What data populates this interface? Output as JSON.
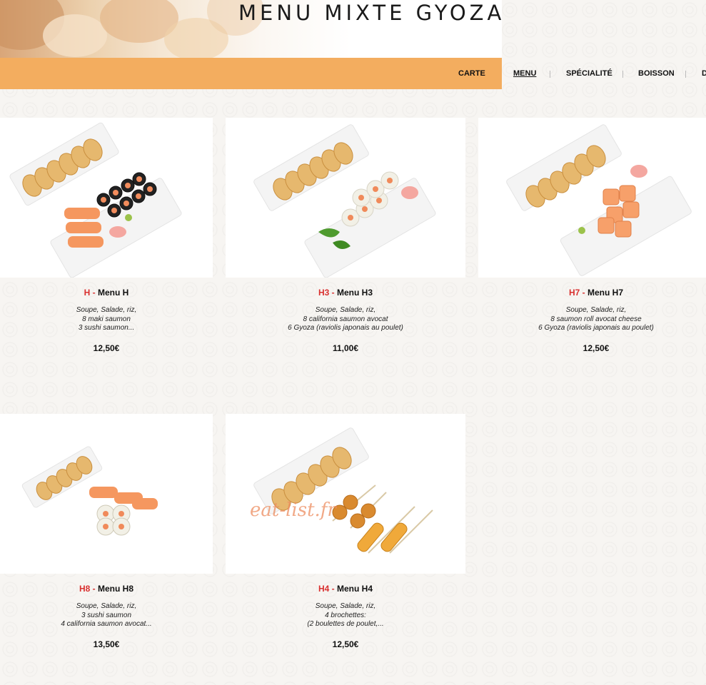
{
  "header": {
    "title": "MENU MIXTE GYOZA"
  },
  "nav": {
    "items": [
      {
        "label": "CARTE",
        "active": false
      },
      {
        "label": "MENU",
        "active": true
      },
      {
        "label": "SPÉCIALITÉ",
        "active": false
      },
      {
        "label": "BOISSON",
        "active": false
      },
      {
        "label": "D",
        "active": false
      }
    ]
  },
  "products": [
    {
      "code": "H",
      "name": "Menu H",
      "desc": [
        "Soupe, Salade, riz,",
        "8 maki saumon",
        "3 sushi saumon..."
      ],
      "price": "12,50€"
    },
    {
      "code": "H3",
      "name": "Menu H3",
      "desc": [
        "Soupe, Salade, riz,",
        "8 california saumon avocat",
        "6 Gyoza (raviolis japonais au poulet)"
      ],
      "price": "11,00€"
    },
    {
      "code": "H7",
      "name": "Menu H7",
      "desc": [
        "Soupe, Salade, riz,",
        "8 saumon roll avocat cheese",
        "6 Gyoza (raviolis japonais au poulet)"
      ],
      "price": "12,50€"
    },
    {
      "code": "H8",
      "name": "Menu H8",
      "desc": [
        "Soupe, Salade, riz,",
        "3 sushi saumon",
        "4 california saumon avocat..."
      ],
      "price": "13,50€"
    },
    {
      "code": "H4",
      "name": "Menu H4",
      "desc": [
        "Soupe, Salade, riz,",
        "4 brochettes:",
        "(2 boulettes de poulet,..."
      ],
      "price": "12,50€"
    }
  ],
  "separator": " - ",
  "watermark": "eat-list.fr",
  "colors": {
    "accent": "#f3ad5f",
    "code_red": "#d9302f"
  }
}
